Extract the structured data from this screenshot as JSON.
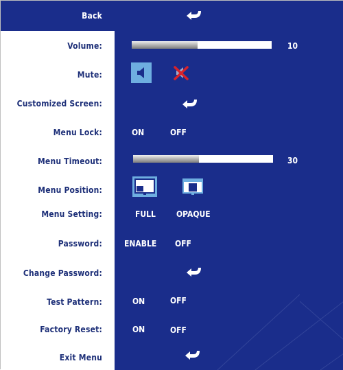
{
  "menu": {
    "back_label": "Back",
    "items": [
      {
        "label": "Volume:",
        "value": "10",
        "level": 0.47
      },
      {
        "label": "Mute:"
      },
      {
        "label": "Customized Screen:"
      },
      {
        "label": "Menu Lock:",
        "options": [
          "ON",
          "OFF"
        ]
      },
      {
        "label": "Menu Timeout:",
        "value": "30",
        "level": 0.47
      },
      {
        "label": "Menu Position:"
      },
      {
        "label": "Menu Setting:",
        "options": [
          "FULL",
          "OPAQUE"
        ]
      },
      {
        "label": "Password:",
        "options": [
          "ENABLE",
          "OFF"
        ]
      },
      {
        "label": "Change Password:"
      },
      {
        "label": "Test Pattern:",
        "options": [
          "ON",
          "OFF"
        ]
      },
      {
        "label": "Factory Reset:",
        "options": [
          "ON",
          "OFF"
        ]
      },
      {
        "label": "Exit Menu"
      }
    ]
  },
  "icons": {
    "enter": "enter-arrow-icon",
    "speaker": "speaker-icon",
    "mute": "speaker-muted-icon",
    "screen_position_1": "menu-position-bottom-icon",
    "screen_position_2": "menu-position-top-icon"
  },
  "colors": {
    "panel_blue": "#1a2d8b",
    "label_text": "#1d2f78",
    "bar_white": "#ffffff",
    "mute_x_red": "#d8222a",
    "icon_highlight": "#6eaee0"
  }
}
